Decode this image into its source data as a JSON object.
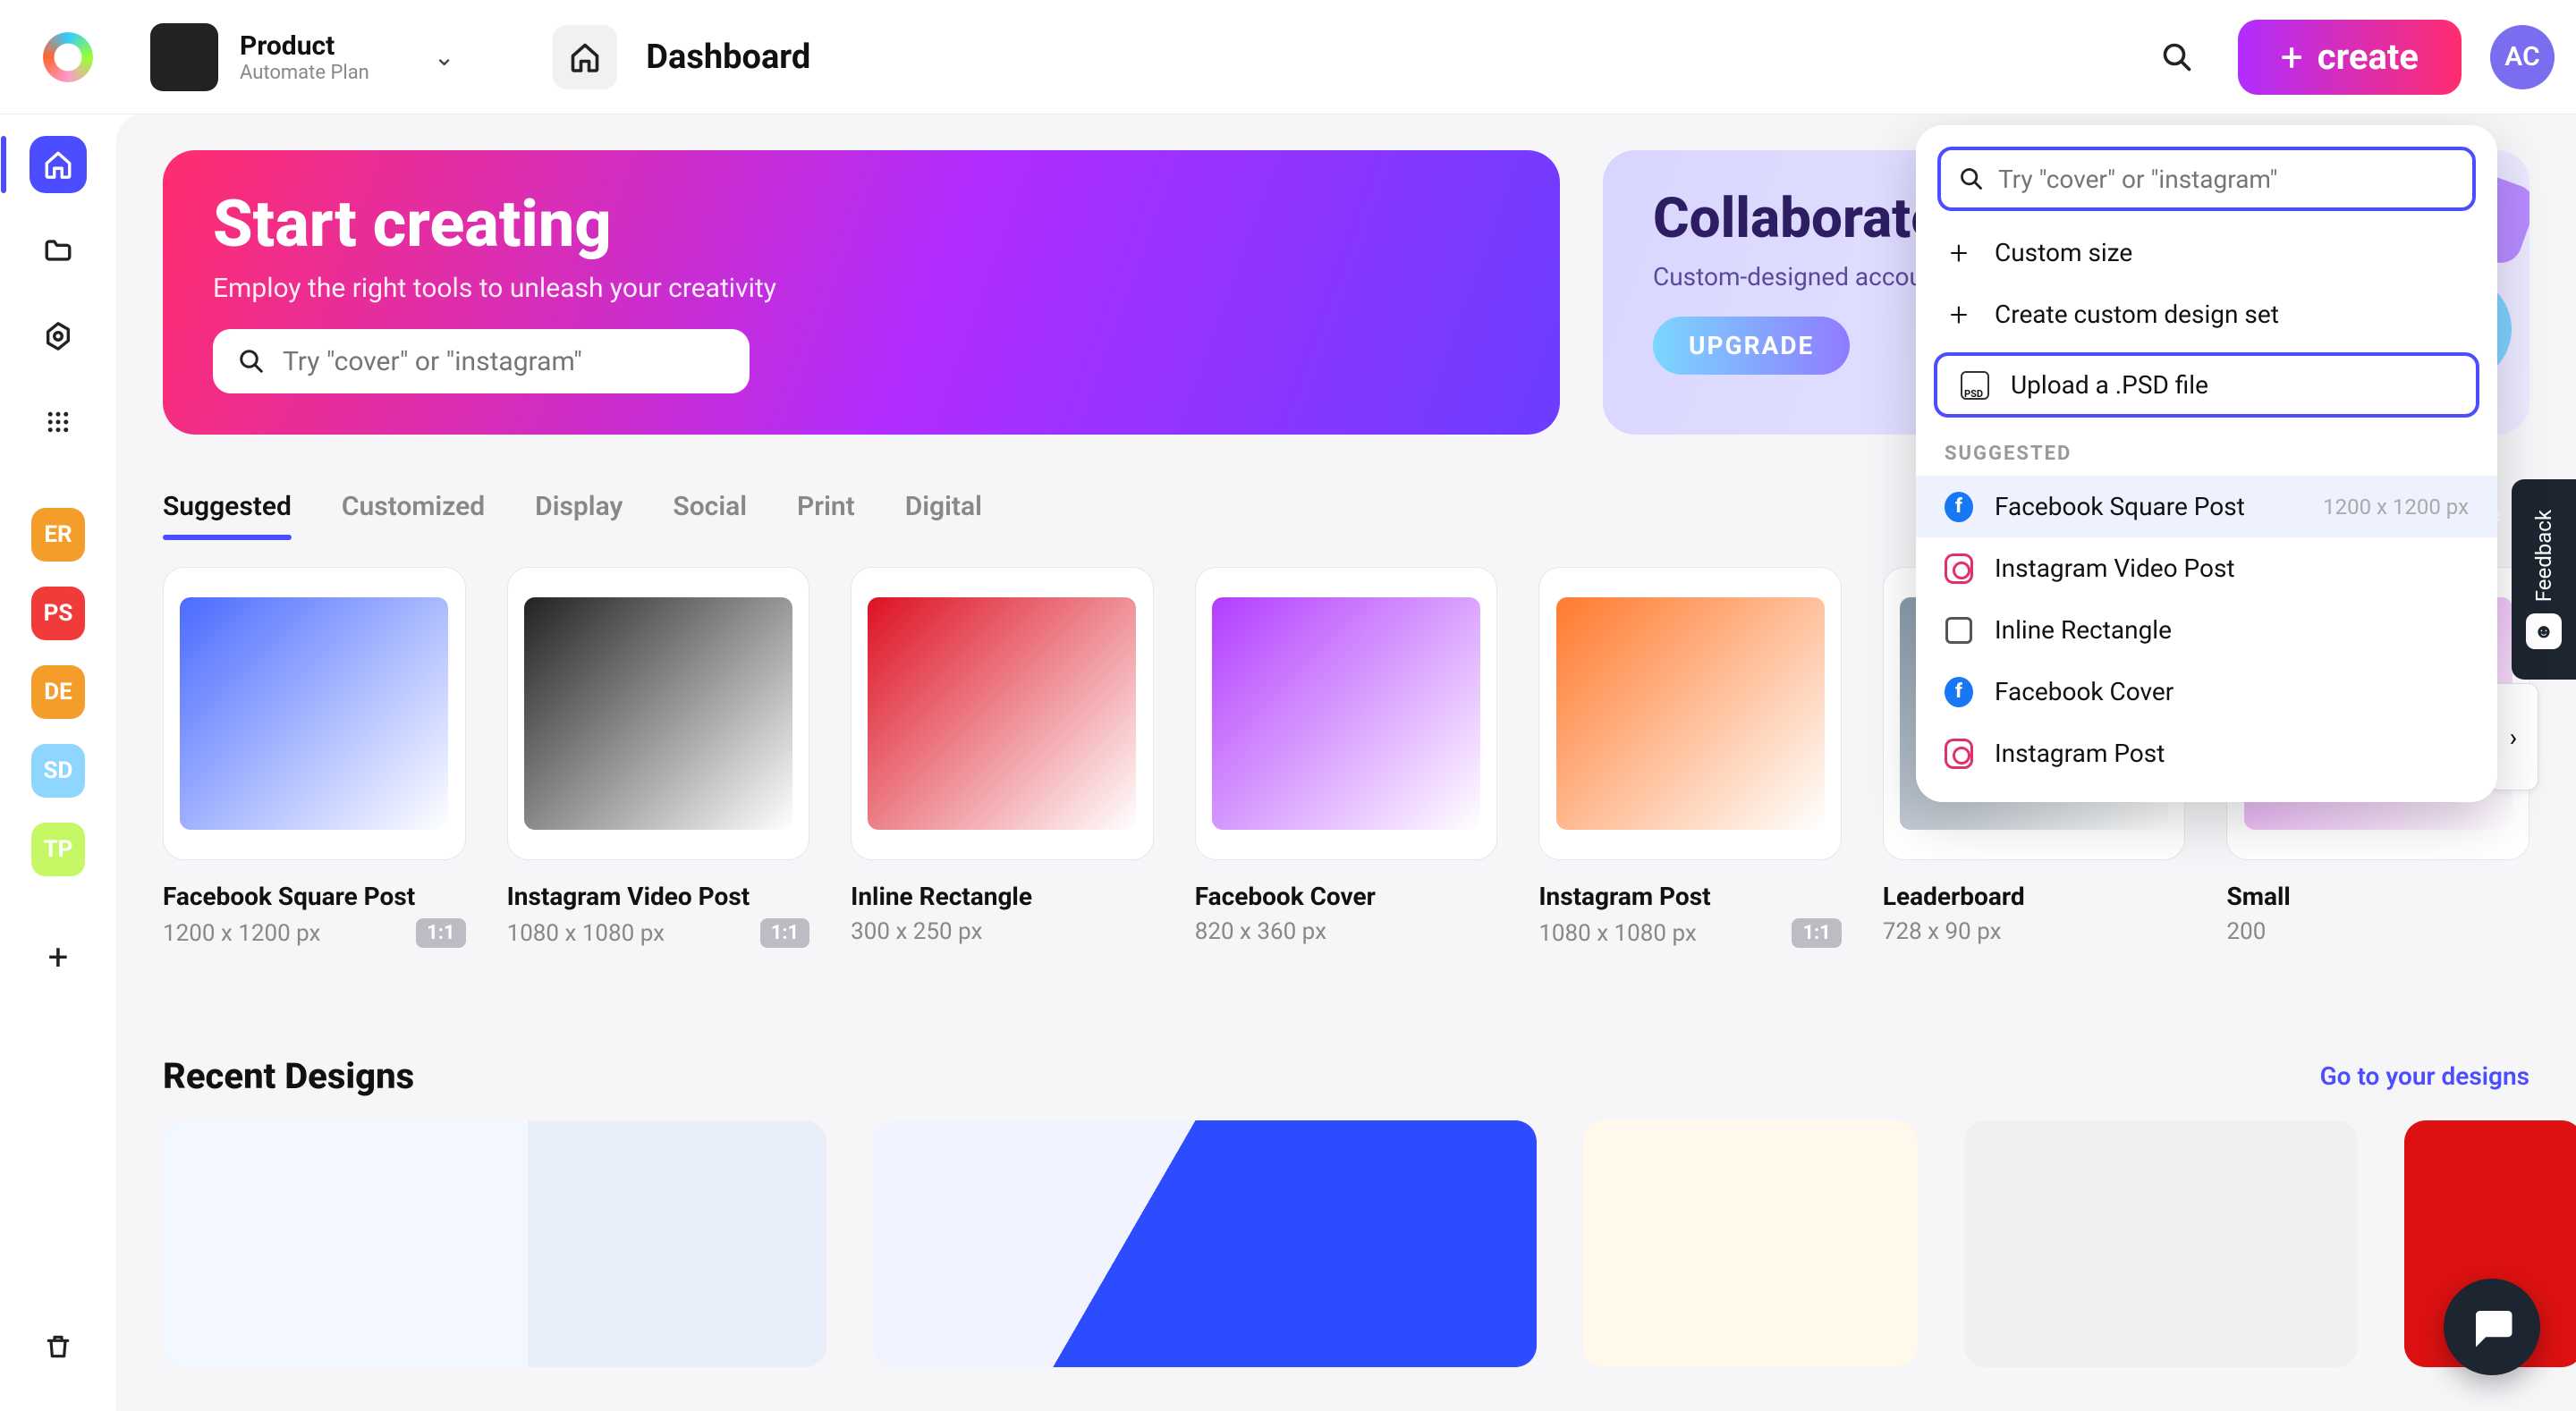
{
  "topbar": {
    "product_name": "Product",
    "plan": "Automate Plan",
    "page_title": "Dashboard",
    "create_label": "create",
    "avatar_initials": "AC"
  },
  "hero": {
    "title": "Start creating",
    "subtitle": "Employ the right tools to unleash your creativity",
    "search_placeholder": "Try \"cover\" or \"instagram\""
  },
  "collab": {
    "title": "Collaborate",
    "subtitle": "Custom-designed accounts",
    "upgrade_label": "UPGRADE"
  },
  "tabs": [
    "Suggested",
    "Customized",
    "Display",
    "Social",
    "Print",
    "Digital"
  ],
  "custom_size_label": "Custom size",
  "templates": [
    {
      "title": "Facebook Square Post",
      "dim": "1200 x 1200 px",
      "ratio": "1:1"
    },
    {
      "title": "Instagram Video Post",
      "dim": "1080 x 1080 px",
      "ratio": "1:1"
    },
    {
      "title": "Inline Rectangle",
      "dim": "300 x 250 px",
      "ratio": null
    },
    {
      "title": "Facebook Cover",
      "dim": "820 x 360 px",
      "ratio": null
    },
    {
      "title": "Instagram Post",
      "dim": "1080 x 1080 px",
      "ratio": "1:1"
    },
    {
      "title": "Leaderboard",
      "dim": "728 x 90 px",
      "ratio": null
    },
    {
      "title": "Small",
      "dim": "200",
      "ratio": null
    }
  ],
  "recent": {
    "heading": "Recent Designs",
    "link": "Go to your designs"
  },
  "leftbar_projects": [
    {
      "label": "ER",
      "color": "#f59d2a"
    },
    {
      "label": "PS",
      "color": "#f13a3a"
    },
    {
      "label": "DE",
      "color": "#f59d2a"
    },
    {
      "label": "SD",
      "color": "#8fd6ff"
    },
    {
      "label": "TP",
      "color": "#c6f764"
    }
  ],
  "create_popover": {
    "search_placeholder": "Try \"cover\" or \"instagram\"",
    "actions": [
      {
        "label": "Custom size",
        "icon": "plus"
      },
      {
        "label": "Create custom design set",
        "icon": "plus"
      },
      {
        "label": "Upload a .PSD file",
        "icon": "psd",
        "boxed": true
      }
    ],
    "suggested_label": "SUGGESTED",
    "suggested": [
      {
        "label": "Facebook Square Post",
        "dim": "1200 x 1200 px",
        "icon": "fb",
        "highlight": true
      },
      {
        "label": "Instagram Video Post",
        "dim": "",
        "icon": "ig"
      },
      {
        "label": "Inline Rectangle",
        "dim": "",
        "icon": "rect"
      },
      {
        "label": "Facebook Cover",
        "dim": "",
        "icon": "fb"
      },
      {
        "label": "Instagram Post",
        "dim": "",
        "icon": "ig"
      }
    ]
  },
  "feedback_label": "Feedback"
}
